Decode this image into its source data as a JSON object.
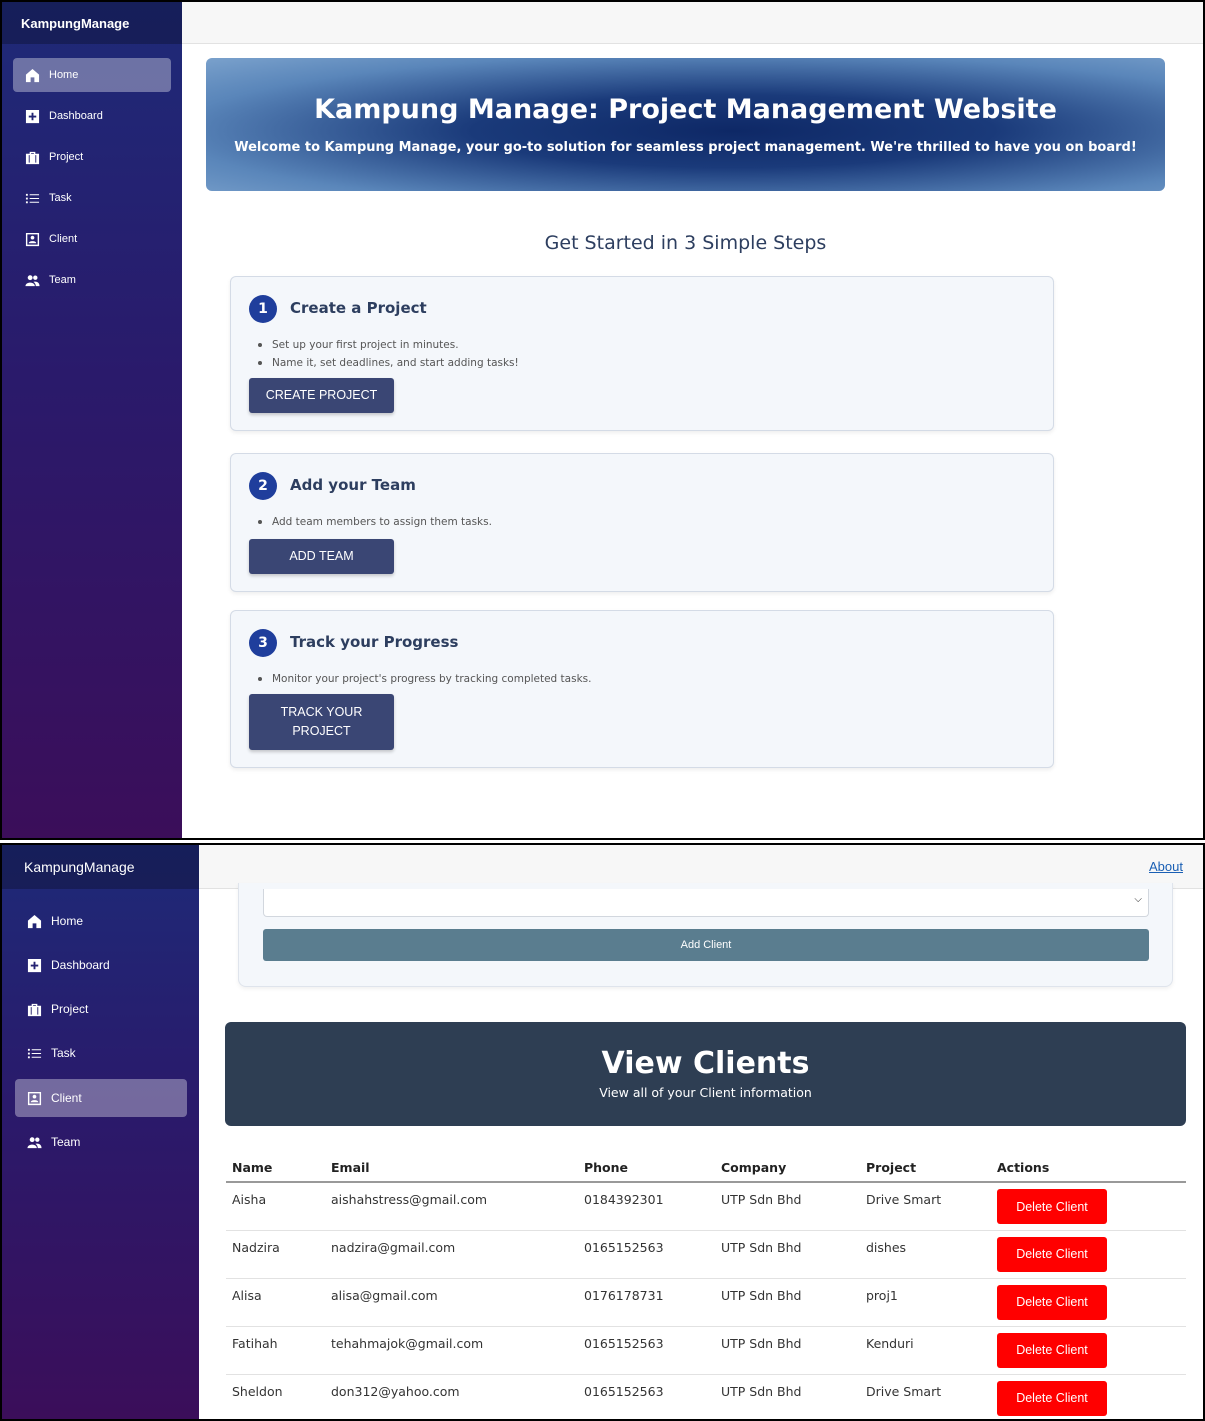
{
  "app": {
    "brand": "KampungManage"
  },
  "sidebar": {
    "items": [
      {
        "label": "Home",
        "icon": "home-icon"
      },
      {
        "label": "Dashboard",
        "icon": "plus-square-icon"
      },
      {
        "label": "Project",
        "icon": "briefcase-icon"
      },
      {
        "label": "Task",
        "icon": "list-icon"
      },
      {
        "label": "Client",
        "icon": "contact-card-icon"
      },
      {
        "label": "Team",
        "icon": "people-icon"
      }
    ]
  },
  "home": {
    "hero_title": "Kampung Manage: Project Management Website",
    "hero_subtitle": "Welcome to Kampung Manage, your go-to solution for seamless project management. We're thrilled to have you on board!",
    "steps_heading": "Get Started in 3 Simple Steps",
    "steps": [
      {
        "number": "1",
        "title": "Create a Project",
        "bullets": [
          "Set up your first project in minutes.",
          "Name it, set deadlines, and start adding tasks!"
        ],
        "button": "CREATE PROJECT"
      },
      {
        "number": "2",
        "title": "Add your Team",
        "bullets": [
          "Add team members to assign them tasks."
        ],
        "button": "ADD TEAM"
      },
      {
        "number": "3",
        "title": "Track your Progress",
        "bullets": [
          "Monitor your project's progress by tracking completed tasks."
        ],
        "button": "TRACK YOUR PROJECT"
      }
    ]
  },
  "client_page": {
    "about_link": "About",
    "add_client_button": "Add Client",
    "view_title": "View Clients",
    "view_subtitle": "View all of your Client information",
    "columns": [
      "Name",
      "Email",
      "Phone",
      "Company",
      "Project",
      "Actions"
    ],
    "delete_label": "Delete Client",
    "rows": [
      {
        "name": "Aisha",
        "email": "aishahstress@gmail.com",
        "phone": "0184392301",
        "company": "UTP Sdn Bhd",
        "project": "Drive Smart"
      },
      {
        "name": "Nadzira",
        "email": "nadzira@gmail.com",
        "phone": "0165152563",
        "company": "UTP Sdn Bhd",
        "project": "dishes"
      },
      {
        "name": "Alisa",
        "email": "alisa@gmail.com",
        "phone": "0176178731",
        "company": "UTP Sdn Bhd",
        "project": "proj1"
      },
      {
        "name": "Fatihah",
        "email": "tehahmajok@gmail.com",
        "phone": "0165152563",
        "company": "UTP Sdn Bhd",
        "project": "Kenduri"
      },
      {
        "name": "Sheldon",
        "email": "don312@yahoo.com",
        "phone": "0165152563",
        "company": "UTP Sdn Bhd",
        "project": "Drive Smart"
      }
    ]
  },
  "colors": {
    "accent": "#1f3e9c",
    "button": "#3a4674",
    "delete": "#ff0000",
    "banner": "#2e3e53"
  }
}
